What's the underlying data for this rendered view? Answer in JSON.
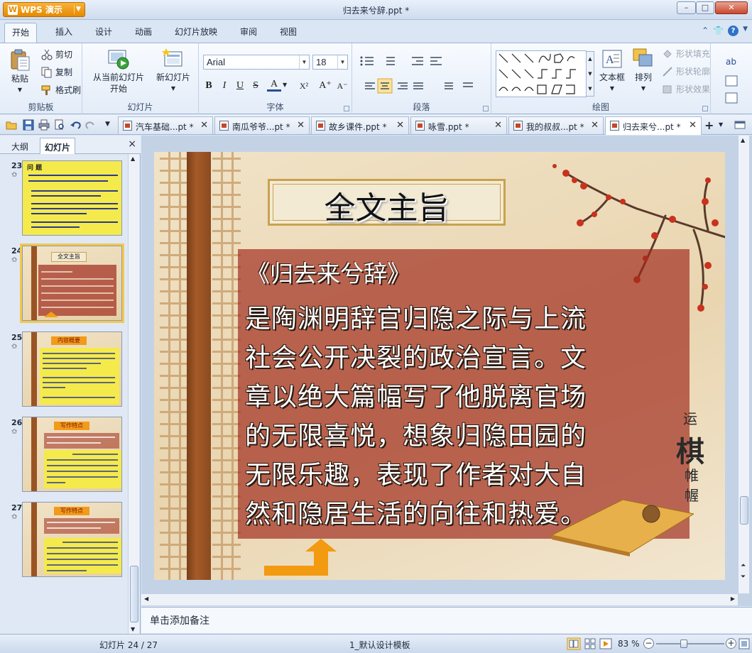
{
  "app": {
    "name": "WPS 演示",
    "window_title": "归去来兮辞.ppt *",
    "controls": {
      "minimize": "–",
      "maximize": "□",
      "close": "✕"
    }
  },
  "ribbon_tabs": [
    "开始",
    "插入",
    "设计",
    "动画",
    "幻灯片放映",
    "审阅",
    "视图"
  ],
  "ribbon": {
    "clipboard": {
      "paste": "粘贴",
      "cut": "剪切",
      "copy": "复制",
      "format_painter": "格式刷",
      "label": "剪贴板"
    },
    "slides": {
      "from_current_line1": "从当前幻灯片",
      "from_current_line2": "开始",
      "new_slide": "新幻灯片",
      "label": "幻灯片"
    },
    "font": {
      "family": "Arial",
      "size": "18",
      "bold": "B",
      "italic": "I",
      "underline": "U",
      "strike": "S",
      "color": "A",
      "superscript": "X²",
      "grow": "A⁺",
      "shrink": "A⁻",
      "label": "字体"
    },
    "paragraph": {
      "label": "段落"
    },
    "drawing": {
      "textbox": "文本框",
      "arrange": "排列",
      "shape_fill": "形状填充",
      "shape_outline": "形状轮廓",
      "shape_effect": "形状效果",
      "label": "绘图"
    }
  },
  "doc_tabs": [
    {
      "label": "汽车基础...pt *",
      "active": false
    },
    {
      "label": "南瓜爷爷...pt *",
      "active": false
    },
    {
      "label": "故乡课件.ppt *",
      "active": false
    },
    {
      "label": "咏雪.ppt *",
      "active": false
    },
    {
      "label": "我的叔叔...pt *",
      "active": false
    },
    {
      "label": "归去来兮...pt *",
      "active": true
    }
  ],
  "left_panel": {
    "tabs": [
      "大纲",
      "幻灯片"
    ],
    "active_tab": "幻灯片",
    "close": "×",
    "thumbnails": [
      {
        "num": "23",
        "title": "问 题",
        "selected": false
      },
      {
        "num": "24",
        "title": "全文主旨",
        "selected": true
      },
      {
        "num": "25",
        "title": "内容概要",
        "selected": false
      },
      {
        "num": "26",
        "title": "写作特点",
        "selected": false
      },
      {
        "num": "27",
        "title": "写作特点",
        "selected": false
      }
    ],
    "star": "✩"
  },
  "slide": {
    "title": "全文主旨",
    "subtitle": "《归去来兮辞》",
    "body_lines": [
      "是陶渊明辞官归隐之际与上流",
      "社会公开决裂的政治宣言。文",
      "章以绝大篇幅写了他脱离官场",
      "的无限喜悦，想象归隐田园的",
      "无限乐趣，表现了作者对大自",
      "然和隐居生活的向往和热爱。"
    ],
    "calligraphy": [
      "运",
      "棋",
      "帷",
      "幄"
    ]
  },
  "notes_placeholder": "单击添加备注",
  "status": {
    "slide_position": "幻灯片 24 / 27",
    "template": "1_默认设计模板",
    "zoom": "83 %"
  },
  "colors": {
    "accent": "#e68a00",
    "ribbon_bg": "#dbe6f4",
    "slide_panel": "#9f2a1c"
  }
}
